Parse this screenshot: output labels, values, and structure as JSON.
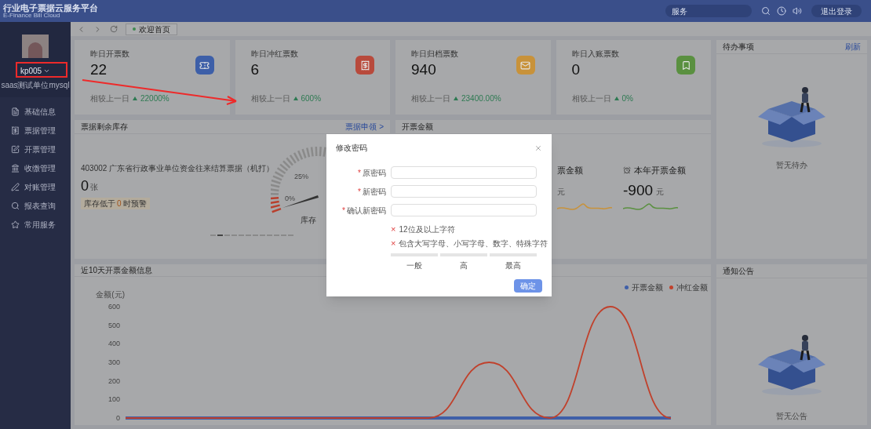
{
  "header": {
    "title": "行业电子票据云服务平台",
    "subtitle": "E-Finance Bill Cloud",
    "search": {
      "value": "服务"
    },
    "logout": "退出登录"
  },
  "user": {
    "name": "kp005",
    "org": "saas测试单位mysql"
  },
  "sidebar": {
    "items": [
      {
        "label": "基础信息"
      },
      {
        "label": "票据管理"
      },
      {
        "label": "开票管理"
      },
      {
        "label": "收缴管理"
      },
      {
        "label": "对账管理"
      },
      {
        "label": "报表查询"
      },
      {
        "label": "常用服务"
      }
    ]
  },
  "tabs": [
    {
      "label": "欢迎首页",
      "selected": true
    }
  ],
  "stats": [
    {
      "label": "昨日开票数",
      "value": "22",
      "compare": "相较上一日",
      "change": "22000%",
      "color": "#3d5fa8"
    },
    {
      "label": "昨日冲红票数",
      "value": "6",
      "compare": "相较上一日",
      "change": "600%",
      "color": "#b84a3c"
    },
    {
      "label": "昨日归档票数",
      "value": "940",
      "compare": "相较上一日",
      "change": "23400.00%",
      "color": "#c8923a"
    },
    {
      "label": "昨日入账票数",
      "value": "0",
      "compare": "相较上一日",
      "change": "0%",
      "color": "#5a9040"
    }
  ],
  "todo": {
    "title": "待办事项",
    "action": "刷新",
    "empty": "暂无待办"
  },
  "inventory": {
    "title": "票据剩余库存",
    "link": "票据申领 >",
    "bill": "403002 广东省行政事业单位资金往来结算票据（机打）",
    "count": "0",
    "unit": "张",
    "warning_prefix": "库存低于",
    "warning_value": "0",
    "warning_suffix": "时预警",
    "gauge_labels": [
      "25%",
      "0%",
      "库存"
    ],
    "carousel_dots": [
      {
        "selected": false
      },
      {
        "selected": true
      },
      {
        "selected": false
      },
      {
        "selected": false
      },
      {
        "selected": false
      },
      {
        "selected": false
      },
      {
        "selected": false
      },
      {
        "selected": false
      },
      {
        "selected": false
      },
      {
        "selected": false
      },
      {
        "selected": false
      },
      {
        "selected": false
      }
    ]
  },
  "amounts": {
    "title": "开票金额",
    "items": [
      {
        "label": "票金额",
        "unit": "元",
        "color": "#c8923a"
      },
      {
        "label": "本年开票金额",
        "value": "-900",
        "unit": "元",
        "color": "#5a9040"
      }
    ]
  },
  "chart": {
    "title": "近10天开票金额信息",
    "chart_data": {
      "type": "line",
      "ylabel": "金额(元)",
      "ylim": [
        0,
        600
      ],
      "yticks": [
        0,
        100,
        200,
        300,
        400,
        500,
        600
      ],
      "legend": "top-right",
      "series": [
        {
          "name": "开票金额",
          "color": "#3f5fa8",
          "values": [
            0,
            0,
            0,
            0,
            0,
            0,
            0,
            0,
            0,
            0
          ]
        },
        {
          "name": "冲红金额",
          "color": "#c0412c",
          "values": [
            0,
            0,
            0,
            0,
            0,
            0,
            300,
            0,
            600,
            0
          ]
        }
      ]
    }
  },
  "notice": {
    "title": "通知公告",
    "empty": "暂无公告"
  },
  "dialog": {
    "title": "修改密码",
    "fields": [
      {
        "label": "原密码",
        "mark": "*"
      },
      {
        "label": "新密码",
        "mark": "*"
      },
      {
        "label": "确认新密码",
        "mark": "*"
      }
    ],
    "rules": [
      {
        "text": "12位及以上字符",
        "icon": "×"
      },
      {
        "text": "包含大写字母、小写字母、数字、特殊字符",
        "icon": "×"
      }
    ],
    "strength": [
      {
        "label": "一般",
        "active": false
      },
      {
        "label": "高",
        "active": false
      },
      {
        "label": "最高",
        "active": false
      }
    ],
    "confirm": "确定"
  }
}
